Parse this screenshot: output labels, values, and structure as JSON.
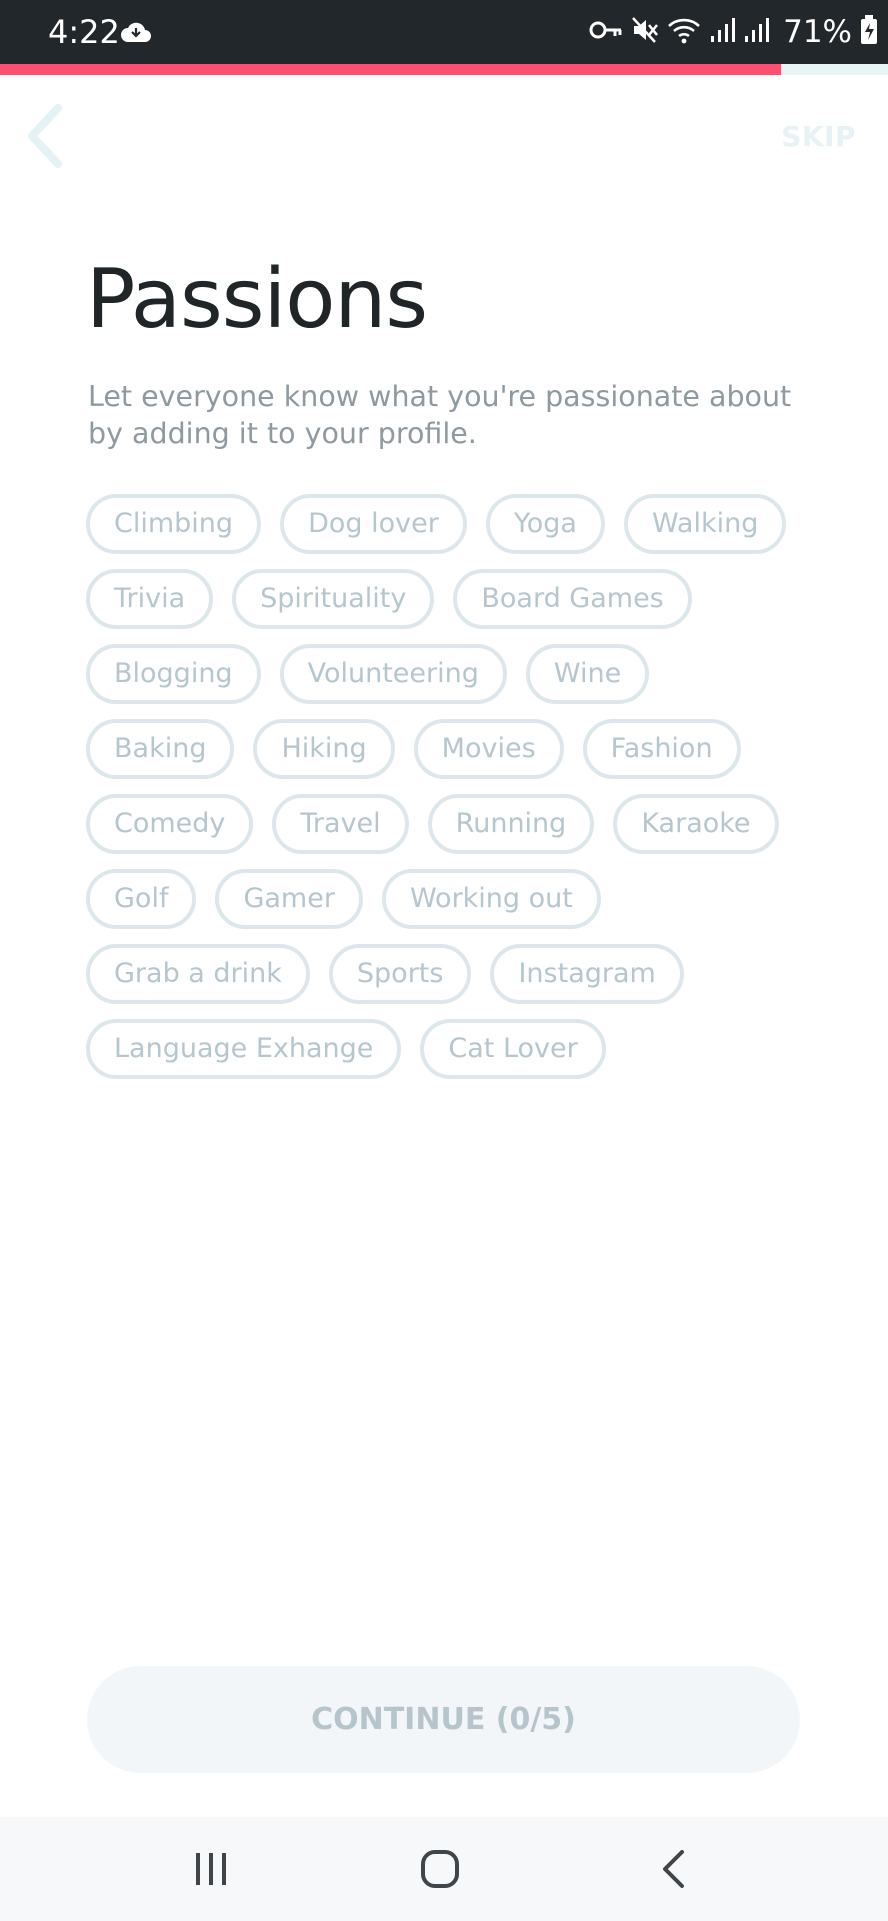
{
  "status_bar": {
    "time": "4:22",
    "battery": "71%",
    "icons": [
      "cloud-icon",
      "key-icon",
      "mute-icon",
      "wifi-icon",
      "signal-icon",
      "signal-icon",
      "battery-icon"
    ]
  },
  "progress": {
    "fraction": 0.88,
    "color": "#fd4f6f"
  },
  "header": {
    "back_icon": "chevron-left-icon",
    "skip_label": "SKIP"
  },
  "title": "Passions",
  "subtitle": "Let everyone know what you're passionate about by adding it to your profile.",
  "passions": [
    "Climbing",
    "Dog lover",
    "Yoga",
    "Walking",
    "Trivia",
    "Spirituality",
    "Board Games",
    "Blogging",
    "Volunteering",
    "Wine",
    "Baking",
    "Hiking",
    "Movies",
    "Fashion",
    "Comedy",
    "Travel",
    "Running",
    "Karaoke",
    "Golf",
    "Gamer",
    "Working out",
    "Grab a drink",
    "Sports",
    "Instagram",
    "Language Exhange",
    "Cat Lover"
  ],
  "continue_label": "CONTINUE (0/5)",
  "nav_bar": {
    "icons": [
      "recents-icon",
      "home-icon",
      "back-icon"
    ]
  }
}
